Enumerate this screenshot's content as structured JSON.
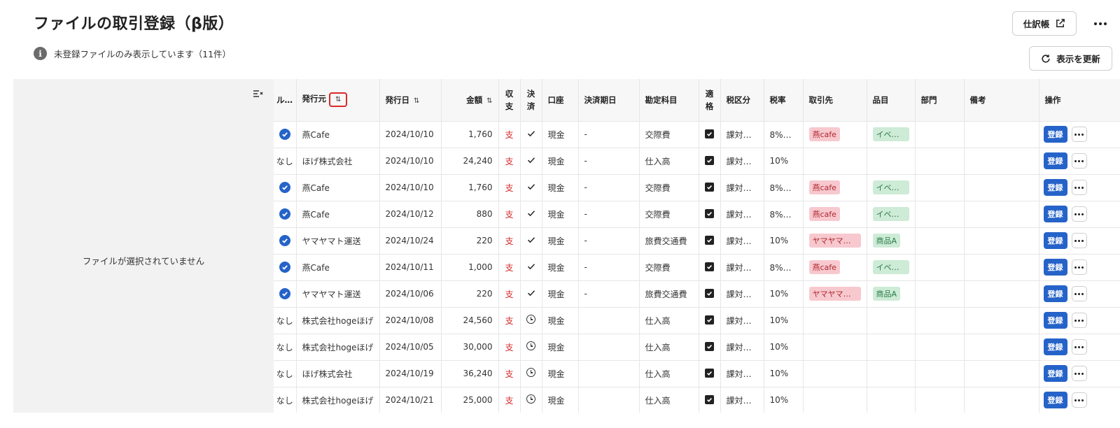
{
  "header": {
    "title": "ファイルの取引登録（β版）",
    "info": "未登録ファイルのみ表示しています（11件）",
    "journal_label": "仕訳帳",
    "refresh_label": "表示を更新"
  },
  "preview": {
    "empty_text": "ファイルが選択されていません"
  },
  "table": {
    "headers": {
      "rule": "ル…",
      "issuer": "発行元",
      "date": "発行日",
      "amount": "金額",
      "io_1": "収",
      "io_2": "支",
      "settled_1": "決",
      "settled_2": "済",
      "account": "口座",
      "due": "決済期日",
      "subject": "勘定科目",
      "qualified_1": "適",
      "qualified_2": "格",
      "tax_cat": "税区分",
      "tax_rate": "税率",
      "partner": "取引先",
      "item": "品目",
      "dept": "部門",
      "memo": "備考",
      "ops": "操作"
    },
    "register_label": "登録",
    "rows": [
      {
        "rule": "check",
        "issuer": "燕Cafe",
        "date": "2024/10/10",
        "amount": "1,760",
        "io": "支",
        "settled": "check",
        "account": "現金",
        "due": "-",
        "subject": "交際費",
        "tax_cat": "課対仕…",
        "tax_rate": "8%（…",
        "partner": "燕cafe",
        "item": "イベン…",
        "dept": "",
        "memo": ""
      },
      {
        "rule": "なし",
        "issuer": "ほげ株式会社",
        "date": "2024/10/10",
        "amount": "24,240",
        "io": "支",
        "settled": "check",
        "account": "現金",
        "due": "-",
        "subject": "仕入高",
        "tax_cat": "課対仕…",
        "tax_rate": "10%",
        "partner": "",
        "item": "",
        "dept": "",
        "memo": ""
      },
      {
        "rule": "check",
        "issuer": "燕Cafe",
        "date": "2024/10/10",
        "amount": "1,760",
        "io": "支",
        "settled": "check",
        "account": "現金",
        "due": "-",
        "subject": "交際費",
        "tax_cat": "課対仕…",
        "tax_rate": "8%（…",
        "partner": "燕cafe",
        "item": "イベン…",
        "dept": "",
        "memo": ""
      },
      {
        "rule": "check",
        "issuer": "燕Cafe",
        "date": "2024/10/12",
        "amount": "880",
        "io": "支",
        "settled": "check",
        "account": "現金",
        "due": "-",
        "subject": "交際費",
        "tax_cat": "課対仕…",
        "tax_rate": "8%（…",
        "partner": "燕cafe",
        "item": "イベン…",
        "dept": "",
        "memo": ""
      },
      {
        "rule": "check",
        "issuer": "ヤマヤマト運送",
        "date": "2024/10/24",
        "amount": "220",
        "io": "支",
        "settled": "check",
        "account": "現金",
        "due": "-",
        "subject": "旅費交通費",
        "tax_cat": "課対仕…",
        "tax_rate": "10%",
        "partner": "ヤマヤマト…",
        "item": "商品A",
        "dept": "",
        "memo": ""
      },
      {
        "rule": "check",
        "issuer": "燕Cafe",
        "date": "2024/10/11",
        "amount": "1,000",
        "io": "支",
        "settled": "check",
        "account": "現金",
        "due": "-",
        "subject": "交際費",
        "tax_cat": "課対仕…",
        "tax_rate": "8%（…",
        "partner": "燕cafe",
        "item": "イベン…",
        "dept": "",
        "memo": ""
      },
      {
        "rule": "check",
        "issuer": "ヤマヤマト運送",
        "date": "2024/10/06",
        "amount": "220",
        "io": "支",
        "settled": "check",
        "account": "現金",
        "due": "-",
        "subject": "旅費交通費",
        "tax_cat": "課対仕…",
        "tax_rate": "10%",
        "partner": "ヤマヤマト…",
        "item": "商品A",
        "dept": "",
        "memo": ""
      },
      {
        "rule": "なし",
        "issuer": "株式会社hogeほげ",
        "date": "2024/10/08",
        "amount": "24,560",
        "io": "支",
        "settled": "clock",
        "account": "現金",
        "due": "",
        "subject": "仕入高",
        "tax_cat": "課対仕…",
        "tax_rate": "10%",
        "partner": "",
        "item": "",
        "dept": "",
        "memo": ""
      },
      {
        "rule": "なし",
        "issuer": "株式会社hogeほげ",
        "date": "2024/10/05",
        "amount": "30,000",
        "io": "支",
        "settled": "clock",
        "account": "現金",
        "due": "",
        "subject": "仕入高",
        "tax_cat": "課対仕…",
        "tax_rate": "10%",
        "partner": "",
        "item": "",
        "dept": "",
        "memo": ""
      },
      {
        "rule": "なし",
        "issuer": "ほげ株式会社",
        "date": "2024/10/19",
        "amount": "36,240",
        "io": "支",
        "settled": "clock",
        "account": "現金",
        "due": "",
        "subject": "仕入高",
        "tax_cat": "課対仕…",
        "tax_rate": "10%",
        "partner": "",
        "item": "",
        "dept": "",
        "memo": ""
      },
      {
        "rule": "なし",
        "issuer": "株式会社hogeほげ",
        "date": "2024/10/21",
        "amount": "25,000",
        "io": "支",
        "settled": "clock",
        "account": "現金",
        "due": "",
        "subject": "仕入高",
        "tax_cat": "課対仕…",
        "tax_rate": "10%",
        "partner": "",
        "item": "",
        "dept": "",
        "memo": ""
      }
    ]
  },
  "colors": {
    "accent": "#2563c9",
    "expense": "#d92b2b",
    "partner_tag_bg": "#f7c9ce",
    "item_tag_bg": "#cdebd6",
    "sort_highlight": "#d92b2b"
  },
  "icons": {
    "info": "info-icon",
    "external": "external-link-icon",
    "more": "more-icon",
    "refresh": "refresh-icon",
    "collapse": "collapse-pane-icon",
    "sort": "sort-icon"
  }
}
